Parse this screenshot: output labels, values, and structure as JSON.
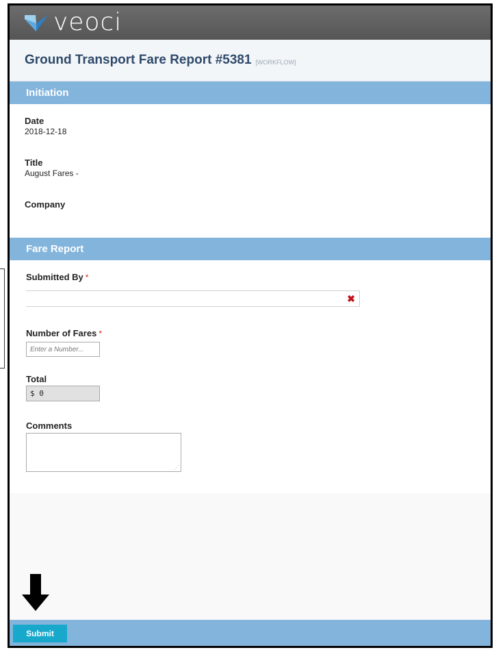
{
  "app": {
    "logo_text": "veoci"
  },
  "form": {
    "title": "Ground Transport Fare Report #5381",
    "type_tag": "[WORKFLOW]"
  },
  "sections": {
    "initiation": {
      "header": "Initiation",
      "fields": {
        "date": {
          "label": "Date",
          "value": "2018-12-18"
        },
        "title": {
          "label": "Title",
          "value": "August Fares -"
        },
        "company": {
          "label": "Company",
          "value": ""
        }
      }
    },
    "fare_report": {
      "header": "Fare Report",
      "submitted_by": {
        "label": "Submitted By",
        "required_mark": "*",
        "value": "",
        "clear_icon": "x-icon"
      },
      "number_of_fares": {
        "label": "Number of Fares",
        "required_mark": "*",
        "placeholder": "Enter a Number...",
        "value": ""
      },
      "total": {
        "label": "Total",
        "value": "$ 0"
      },
      "comments": {
        "label": "Comments",
        "value": ""
      }
    }
  },
  "footer": {
    "submit_label": "Submit"
  },
  "colors": {
    "section_header": "#83b4dc",
    "submit_button": "#17a8cc",
    "title_text": "#2f4a6a",
    "required": "#d9261c"
  }
}
